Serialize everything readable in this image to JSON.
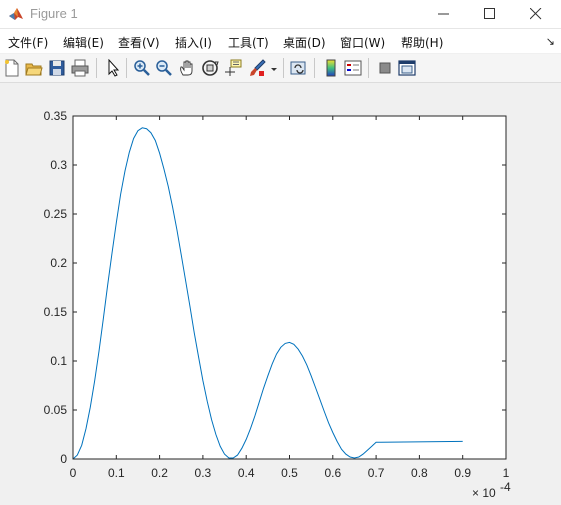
{
  "window": {
    "title": "Figure 1",
    "icon": "matlab-logo-icon"
  },
  "menu": [
    {
      "label": "文件(F)"
    },
    {
      "label": "编辑(E)"
    },
    {
      "label": "查看(V)"
    },
    {
      "label": "插入(I)"
    },
    {
      "label": "工具(T)"
    },
    {
      "label": "桌面(D)"
    },
    {
      "label": "窗口(W)"
    },
    {
      "label": "帮助(H)"
    }
  ],
  "menu_overflow_icon": "dock-arrow-icon",
  "toolbar": [
    "new-figure-icon",
    "open-file-icon",
    "save-icon",
    "print-icon",
    "edit-plot-arrow-icon",
    "zoom-in-icon",
    "zoom-out-icon",
    "pan-hand-icon",
    "rotate-3d-icon",
    "data-cursor-icon",
    "brush-icon",
    "brush-dropdown-icon",
    "link-plot-icon",
    "colorbar-icon",
    "legend-icon",
    "hide-plot-tools-icon",
    "show-plot-tools-icon"
  ],
  "chart_data": {
    "type": "line",
    "title": "",
    "xlabel": "",
    "ylabel": "",
    "xlim": [
      0,
      1
    ],
    "ylim": [
      0,
      0.35
    ],
    "x_exponent_label": "× 10",
    "x_exponent_power": "-4",
    "xticks": [
      "0",
      "0.1",
      "0.2",
      "0.3",
      "0.4",
      "0.5",
      "0.6",
      "0.7",
      "0.8",
      "0.9",
      "1"
    ],
    "yticks": [
      "0",
      "0.05",
      "0.1",
      "0.15",
      "0.2",
      "0.25",
      "0.3",
      "0.35"
    ],
    "grid": false,
    "line_color": "#0072bd",
    "series": [
      {
        "x": [
          0,
          0.01,
          0.02,
          0.03,
          0.04,
          0.05,
          0.06,
          0.07,
          0.08,
          0.09,
          0.1,
          0.11,
          0.12,
          0.13,
          0.14,
          0.15,
          0.16,
          0.17,
          0.18,
          0.19,
          0.2,
          0.21,
          0.22,
          0.23,
          0.24,
          0.25,
          0.26,
          0.27,
          0.28,
          0.29,
          0.3,
          0.31,
          0.32,
          0.33,
          0.34,
          0.35,
          0.36,
          0.37,
          0.38,
          0.39,
          0.4,
          0.41,
          0.42,
          0.43,
          0.44,
          0.45,
          0.46,
          0.47,
          0.48,
          0.49,
          0.5,
          0.51,
          0.52,
          0.53,
          0.54,
          0.55,
          0.56,
          0.57,
          0.58,
          0.59,
          0.6,
          0.61,
          0.62,
          0.63,
          0.64,
          0.65,
          0.66,
          0.67,
          0.68,
          0.69,
          0.7,
          0.71,
          0.72,
          0.73,
          0.74,
          0.75,
          0.76,
          0.77,
          0.78,
          0.79,
          0.8,
          0.81,
          0.82,
          0.83,
          0.84,
          0.85,
          0.86,
          0.87,
          0.88,
          0.89,
          0.9
        ],
        "y": [
          0,
          0.004,
          0.014,
          0.031,
          0.053,
          0.08,
          0.11,
          0.143,
          0.177,
          0.21,
          0.241,
          0.27,
          0.294,
          0.313,
          0.327,
          0.335,
          0.338,
          0.337,
          0.333,
          0.325,
          0.312,
          0.296,
          0.278,
          0.257,
          0.234,
          0.208,
          0.182,
          0.156,
          0.129,
          0.104,
          0.08,
          0.059,
          0.04,
          0.025,
          0.013,
          0.005,
          0.001,
          0.001,
          0.004,
          0.011,
          0.02,
          0.031,
          0.044,
          0.058,
          0.072,
          0.085,
          0.097,
          0.107,
          0.114,
          0.118,
          0.119,
          0.117,
          0.112,
          0.105,
          0.096,
          0.085,
          0.073,
          0.061,
          0.049,
          0.037,
          0.027,
          0.018,
          0.01,
          0.005,
          0.002,
          0.001,
          0.002,
          0.005,
          0.009,
          0.013,
          0.017,
          0.0,
          0.0,
          0.0,
          0.0,
          0.0,
          0.0,
          0.0,
          0.0,
          0.0,
          0.0,
          0.0,
          0.0,
          0.0,
          0.0,
          0.0,
          0.0,
          0.0,
          0.0,
          0.0,
          0.0
        ]
      }
    ]
  }
}
